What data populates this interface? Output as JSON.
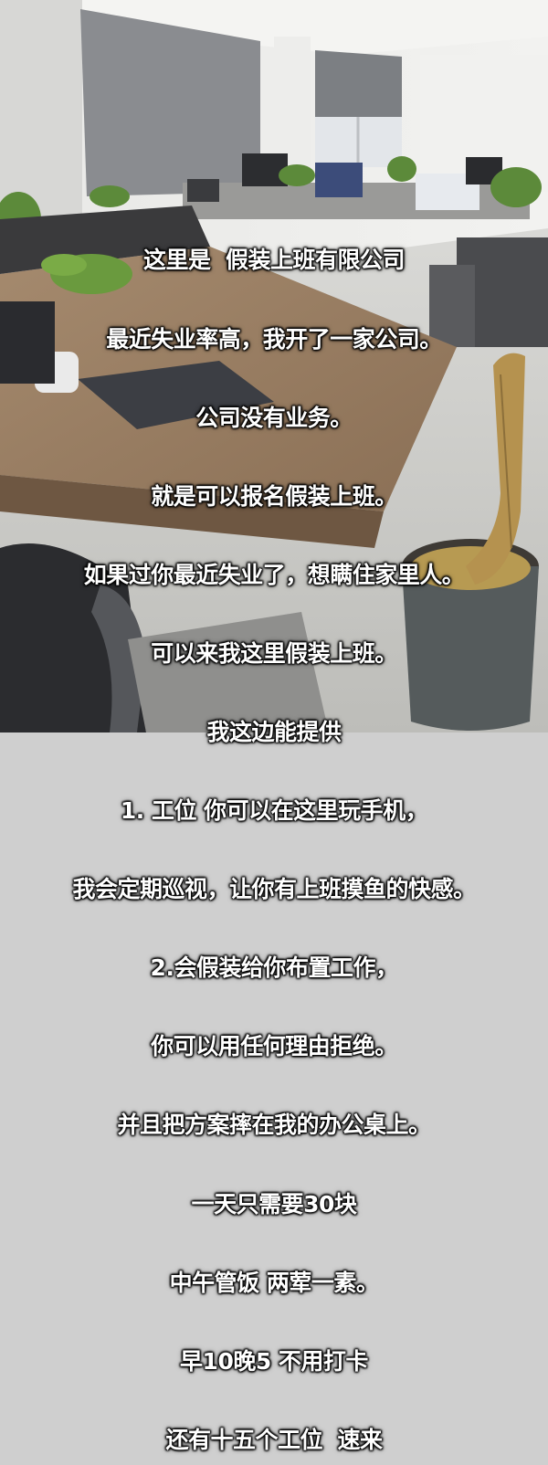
{
  "caption_lines": [
    "这里是  假装上班有限公司",
    "最近失业率高，我开了一家公司。",
    "公司没有业务。",
    "就是可以报名假装上班。",
    "如果过你最近失业了，想瞒住家里人。",
    "可以来我这里假装上班。",
    "我这边能提供",
    "1. 工位 你可以在这里玩手机，",
    "我会定期巡视，让你有上班摸鱼的快感。",
    "2.会假装给你布置工作，",
    "你可以用任何理由拒绝。",
    "并且把方案摔在我的办公桌上。",
    "一天只需要30块",
    "中午管饭 两荤一素。",
    "早10晚5 不用打卡",
    "还有十五个工位  速来"
  ]
}
